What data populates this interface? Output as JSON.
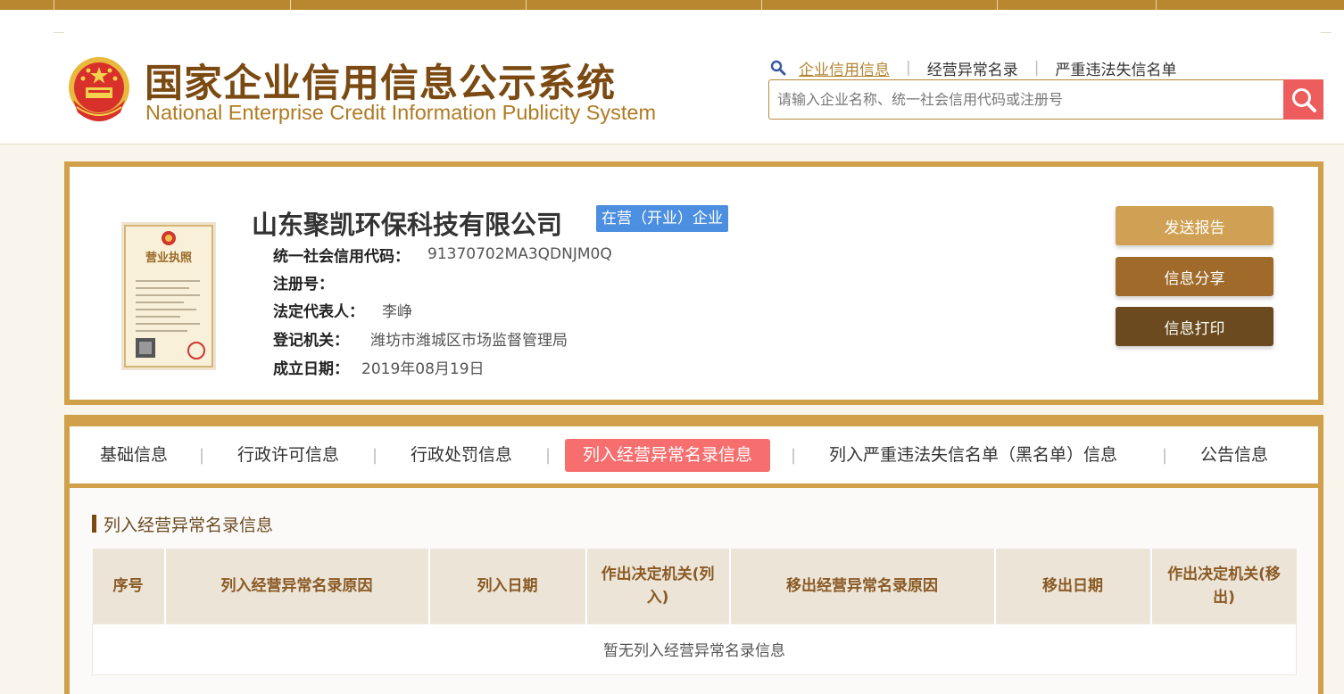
{
  "header": {
    "title_cn": "国家企业信用信息公示系统",
    "title_en": "National Enterprise Credit Information Publicity System",
    "nav": [
      "企业信用信息",
      "经营异常名录",
      "严重违法失信名单"
    ],
    "search_placeholder": "请输入企业名称、统一社会信用代码或注册号"
  },
  "company": {
    "name": "山东聚凯环保科技有限公司",
    "status": "在营（开业）企业",
    "fields": [
      {
        "label": "统一社会信用代码：",
        "value": "91370702MA3QDNJM0Q"
      },
      {
        "label": "注册号：",
        "value": ""
      },
      {
        "label": "法定代表人：",
        "value": "李峥"
      },
      {
        "label": "登记机关：",
        "value": "潍坊市潍城区市场监督管理局"
      },
      {
        "label": "成立日期：",
        "value": "2019年08月19日"
      }
    ],
    "license_title": "营业执照"
  },
  "actions": {
    "send_report": "发送报告",
    "share": "信息分享",
    "print": "信息打印"
  },
  "tabs": [
    "基础信息",
    "行政许可信息",
    "行政处罚信息",
    "列入经营异常名录信息",
    "列入严重违法失信名单（黑名单）信息",
    "公告信息"
  ],
  "section": {
    "title": "列入经营异常名录信息",
    "columns": [
      "序号",
      "列入经营异常名录原因",
      "列入日期",
      "作出决定机关(列入)",
      "移出经营异常名录原因",
      "移出日期",
      "作出决定机关(移出)"
    ],
    "empty_text": "暂无列入经营异常名录信息"
  },
  "colors": {
    "brand_brown": "#7a4a12",
    "brand_gold": "#d1a04a",
    "active_tab": "#f76e6e",
    "status_badge": "#4c8ee0",
    "search_button": "#ee5d5d"
  }
}
